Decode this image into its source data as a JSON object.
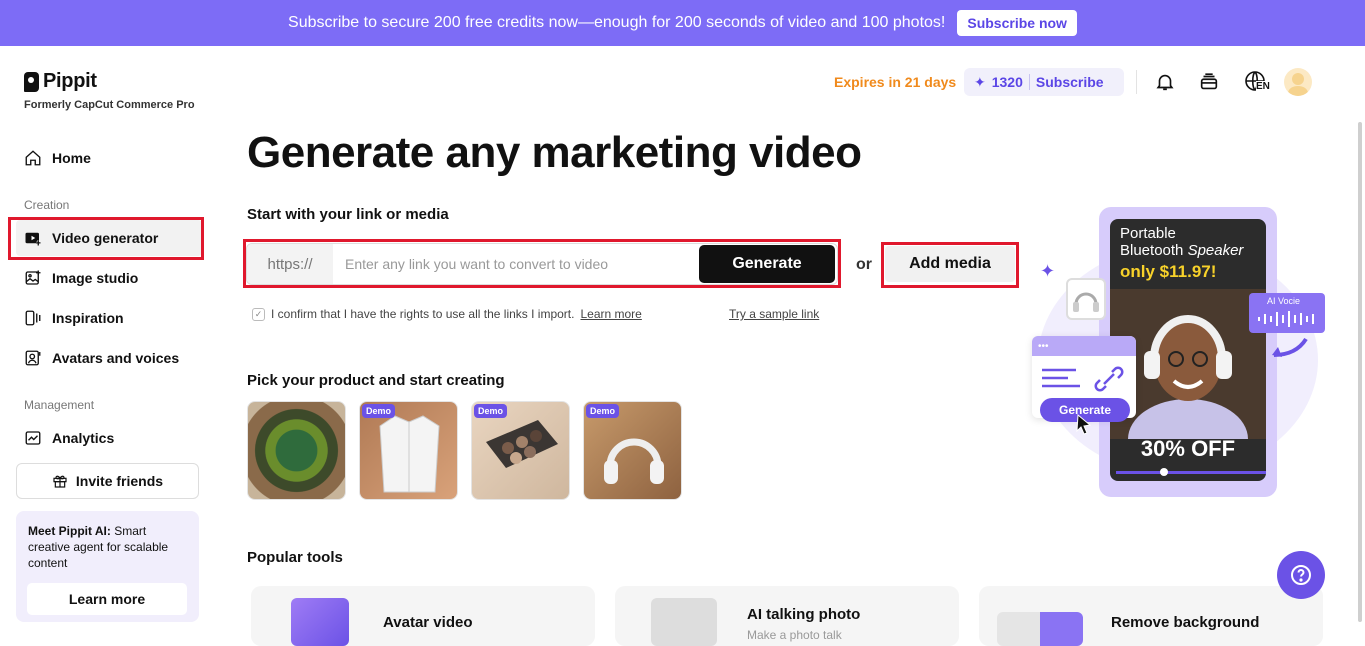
{
  "banner": {
    "text": "Subscribe to secure 200 free credits now—enough for 200 seconds of video and 100 photos!",
    "button": "Subscribe now"
  },
  "brand": {
    "name": "Pippit",
    "tagline": "Formerly CapCut Commerce Pro"
  },
  "header": {
    "expires": "Expires in 21 days",
    "credits": "1320",
    "subscribe": "Subscribe",
    "language": "EN",
    "icons": [
      "bell-icon",
      "stack-icon",
      "globe-icon",
      "avatar"
    ]
  },
  "sidebar": {
    "home": "Home",
    "section_creation": "Creation",
    "items": [
      {
        "label": "Video generator",
        "icon": "video-plus-icon",
        "active": true
      },
      {
        "label": "Image studio",
        "icon": "image-plus-icon"
      },
      {
        "label": "Inspiration",
        "icon": "inspiration-icon"
      },
      {
        "label": "Avatars and voices",
        "icon": "avatar-icon"
      }
    ],
    "section_management": "Management",
    "analytics": "Analytics",
    "invite": "Invite friends",
    "promo": {
      "title": "Meet Pippit AI:",
      "body": "Smart creative agent for scalable content",
      "button": "Learn more"
    }
  },
  "main": {
    "title": "Generate any marketing video",
    "link_section": "Start with your link or media",
    "prefix": "https://",
    "placeholder": "Enter any link you want to convert to video",
    "generate": "Generate",
    "or": "or",
    "add_media": "Add media",
    "confirm_text": "I confirm that I have the rights to use all the links I import.",
    "learn_more": "Learn more",
    "try_sample": "Try a sample link",
    "product_section": "Pick your product and start creating",
    "demo_badge": "Demo",
    "tools_section": "Popular tools",
    "tools": [
      {
        "title": "Avatar video"
      },
      {
        "title": "AI talking photo",
        "subtitle": "Make a photo talk"
      },
      {
        "title": "Remove background"
      }
    ]
  },
  "hero": {
    "line1": "Portable",
    "line2a": "Bluetooth",
    "line2b": "Speaker",
    "price": "only $11.97!",
    "ai_voice": "AI Vocie",
    "generate": "Generate",
    "discount": "30% OFF"
  },
  "colors": {
    "accent": "#7d6cf6",
    "brand_purple": "#6b52e6",
    "orange": "#f08a1c",
    "highlight": "#e0182d"
  }
}
